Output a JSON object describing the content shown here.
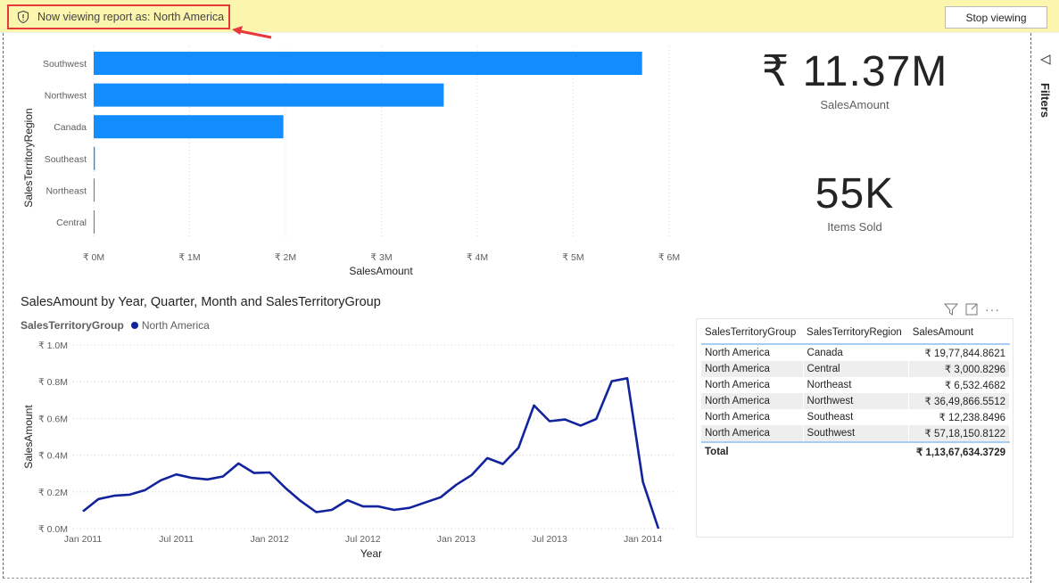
{
  "banner": {
    "message": "Now viewing report as: North America",
    "stop_button": "Stop viewing"
  },
  "filters_pane": {
    "label": "Filters"
  },
  "colors": {
    "bar": "#118dff",
    "line": "#12239e",
    "banner": "#fbf5ad",
    "highlight": "#e5393b"
  },
  "kpis": [
    {
      "value": "₹ 11.37M",
      "label": "SalesAmount"
    },
    {
      "value": "55K",
      "label": "Items Sold"
    }
  ],
  "chart_data": [
    {
      "type": "bar",
      "orientation": "horizontal",
      "xlabel": "SalesAmount",
      "ylabel": "SalesTerritoryRegion",
      "categories": [
        "Southwest",
        "Northwest",
        "Canada",
        "Southeast",
        "Northeast",
        "Central"
      ],
      "values": [
        5718150.81,
        3649866.55,
        1977844.86,
        12238.85,
        6532.47,
        3000.83
      ],
      "xlim": [
        0,
        6000000
      ],
      "x_ticks": [
        "₹ 0M",
        "₹ 1M",
        "₹ 2M",
        "₹ 3M",
        "₹ 4M",
        "₹ 5M",
        "₹ 6M"
      ]
    },
    {
      "type": "line",
      "title": "SalesAmount by Year, Quarter, Month and SalesTerritoryGroup",
      "legend_title": "SalesTerritoryGroup",
      "legend": [
        "North America"
      ],
      "xlabel": "Year",
      "ylabel": "SalesAmount",
      "ylim": [
        0,
        1.0
      ],
      "y_ticks": [
        "₹ 0.0M",
        "₹ 0.2M",
        "₹ 0.4M",
        "₹ 0.6M",
        "₹ 0.8M",
        "₹ 1.0M"
      ],
      "x_ticks": [
        "Jan 2011",
        "Jul 2011",
        "Jan 2012",
        "Jul 2012",
        "Jan 2013",
        "Jul 2013",
        "Jan 2014"
      ],
      "series": [
        {
          "name": "North America",
          "values_millions": [
            0.094,
            0.161,
            0.179,
            0.185,
            0.21,
            0.263,
            0.295,
            0.276,
            0.268,
            0.284,
            0.355,
            0.303,
            0.306,
            0.223,
            0.15,
            0.09,
            0.102,
            0.155,
            0.121,
            0.121,
            0.102,
            0.113,
            0.142,
            0.171,
            0.239,
            0.292,
            0.384,
            0.352,
            0.44,
            0.671,
            0.585,
            0.594,
            0.561,
            0.597,
            0.803,
            0.819,
            0.255,
            0.0
          ]
        }
      ]
    }
  ],
  "table": {
    "headers": [
      "SalesTerritoryGroup",
      "SalesTerritoryRegion",
      "SalesAmount"
    ],
    "rows": [
      [
        "North America",
        "Canada",
        "₹ 19,77,844.8621"
      ],
      [
        "North America",
        "Central",
        "₹ 3,000.8296"
      ],
      [
        "North America",
        "Northeast",
        "₹ 6,532.4682"
      ],
      [
        "North America",
        "Northwest",
        "₹ 36,49,866.5512"
      ],
      [
        "North America",
        "Southeast",
        "₹ 12,238.8496"
      ],
      [
        "North America",
        "Southwest",
        "₹ 57,18,150.8122"
      ]
    ],
    "total_label": "Total",
    "total_value": "₹ 1,13,67,634.3729"
  }
}
